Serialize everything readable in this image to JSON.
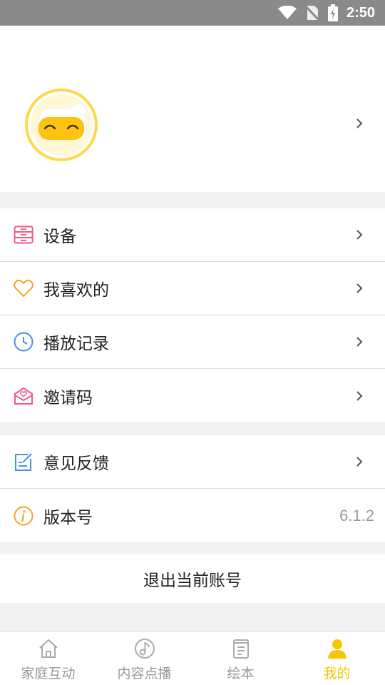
{
  "status_bar": {
    "time": "2:50"
  },
  "profile": {},
  "menu_group_1": [
    {
      "label": "设备",
      "icon": "device-icon"
    },
    {
      "label": "我喜欢的",
      "icon": "heart-icon"
    },
    {
      "label": "播放记录",
      "icon": "clock-icon"
    },
    {
      "label": "邀请码",
      "icon": "invite-envelope-icon"
    }
  ],
  "menu_group_2": [
    {
      "label": "意见反馈",
      "icon": "feedback-edit-icon"
    },
    {
      "label": "版本号",
      "icon": "info-icon",
      "value": "6.1.2"
    }
  ],
  "logout_label": "退出当前账号",
  "tabbar": [
    {
      "label": "家庭互动",
      "icon": "home-icon",
      "active": false
    },
    {
      "label": "内容点播",
      "icon": "music-note-icon",
      "active": false
    },
    {
      "label": "绘本",
      "icon": "book-icon",
      "active": false
    },
    {
      "label": "我的",
      "icon": "person-icon",
      "active": true
    }
  ],
  "colors": {
    "accent": "#f7c600",
    "pink": "#ee5b86",
    "orange": "#f5a623",
    "blue": "#4a90e2"
  }
}
